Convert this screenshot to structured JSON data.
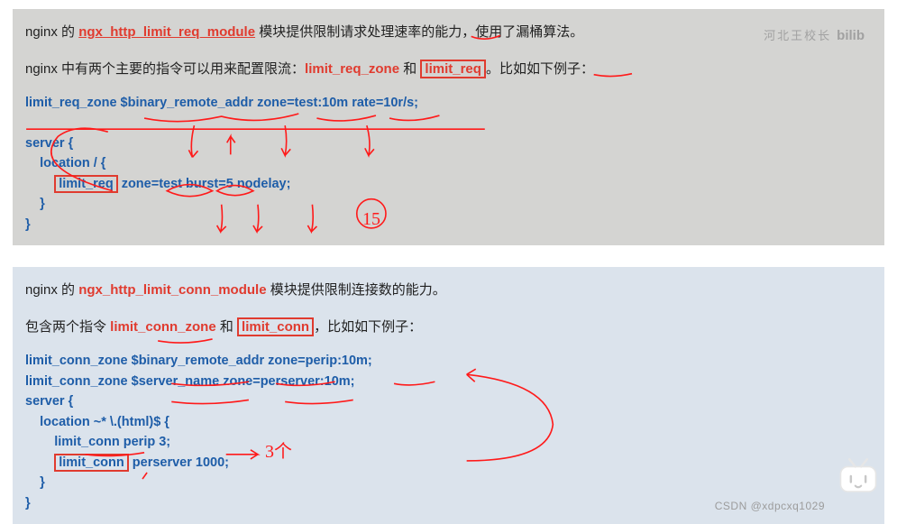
{
  "block1": {
    "p1_pre": "nginx 的 ",
    "p1_mod": "ngx_http_limit_req_module",
    "p1_post": " 模块提供限制请求处理速率的能力，使用了漏桶算法。",
    "p2_pre": "nginx 中有两个主要的指令可以用来配置限流：",
    "p2_d1": "limit_req_zone",
    "p2_mid": " 和 ",
    "p2_d2": "limit_req",
    "p2_post": "。比如如下例子：",
    "code_l1": "limit_req_zone $binary_remote_addr zone=test:10m rate=10r/s;",
    "code_l2": "server {",
    "code_l3_a": "    location / {",
    "code_l4_a": "        ",
    "code_l4_b": "limit_req",
    "code_l4_c": " zone=test burst=5 nodelay;",
    "code_l5": "    }",
    "code_l6": "}",
    "annot_15": "15"
  },
  "block2": {
    "p1_pre": "nginx 的 ",
    "p1_mod": "ngx_http_limit_conn_module",
    "p1_post": " 模块提供限制连接数的能力。",
    "p2_pre": "包含两个指令 ",
    "p2_d1": "limit_conn_zone",
    "p2_mid": " 和 ",
    "p2_d2": "limit_conn",
    "p2_post": "，比如如下例子：",
    "code_l1": "limit_conn_zone $binary_remote_addr zone=perip:10m;",
    "code_l2": "limit_conn_zone $server_name zone=perserver:10m;",
    "code_l3": "server {",
    "code_l4": "    location ~* \\.(html)$ {",
    "code_l5": "        limit_conn perip 3;",
    "code_l6_a": "        ",
    "code_l6_b": "limit_conn",
    "code_l6_c": " perserver 1000;",
    "code_l7": "    }",
    "code_l8": "}",
    "annot_3": "3个"
  },
  "watermark_top": "河北王校长",
  "watermark_bili": "bilib",
  "watermark_bot": "CSDN @xdpcxq1029"
}
